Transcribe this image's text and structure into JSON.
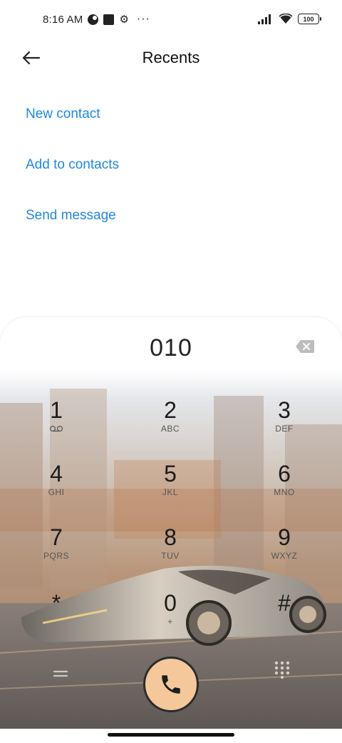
{
  "status_bar": {
    "time": "8:16 AM",
    "more": "···",
    "battery": "100",
    "icons": [
      "vpn-half-circle-icon",
      "square-notification-icon",
      "gear-icon",
      "signal-icon",
      "wifi-icon",
      "battery-icon"
    ]
  },
  "header": {
    "title": "Recents",
    "back_icon": "arrow-left-icon"
  },
  "actions": [
    {
      "label": "New contact"
    },
    {
      "label": "Add to contacts"
    },
    {
      "label": "Send message"
    }
  ],
  "dialer": {
    "number": "010",
    "keys": [
      {
        "digit": "1",
        "letters": ""
      },
      {
        "digit": "2",
        "letters": "ABC"
      },
      {
        "digit": "3",
        "letters": "DEF"
      },
      {
        "digit": "4",
        "letters": "GHI"
      },
      {
        "digit": "5",
        "letters": "JKL"
      },
      {
        "digit": "6",
        "letters": "MNO"
      },
      {
        "digit": "7",
        "letters": "PQRS"
      },
      {
        "digit": "8",
        "letters": "TUV"
      },
      {
        "digit": "9",
        "letters": "WXYZ"
      },
      {
        "digit": "*",
        "letters": ""
      },
      {
        "digit": "0",
        "letters": "+"
      },
      {
        "digit": "#",
        "letters": ""
      }
    ]
  },
  "colors": {
    "link": "#1e88e5",
    "call_button": "#f4c89a"
  }
}
